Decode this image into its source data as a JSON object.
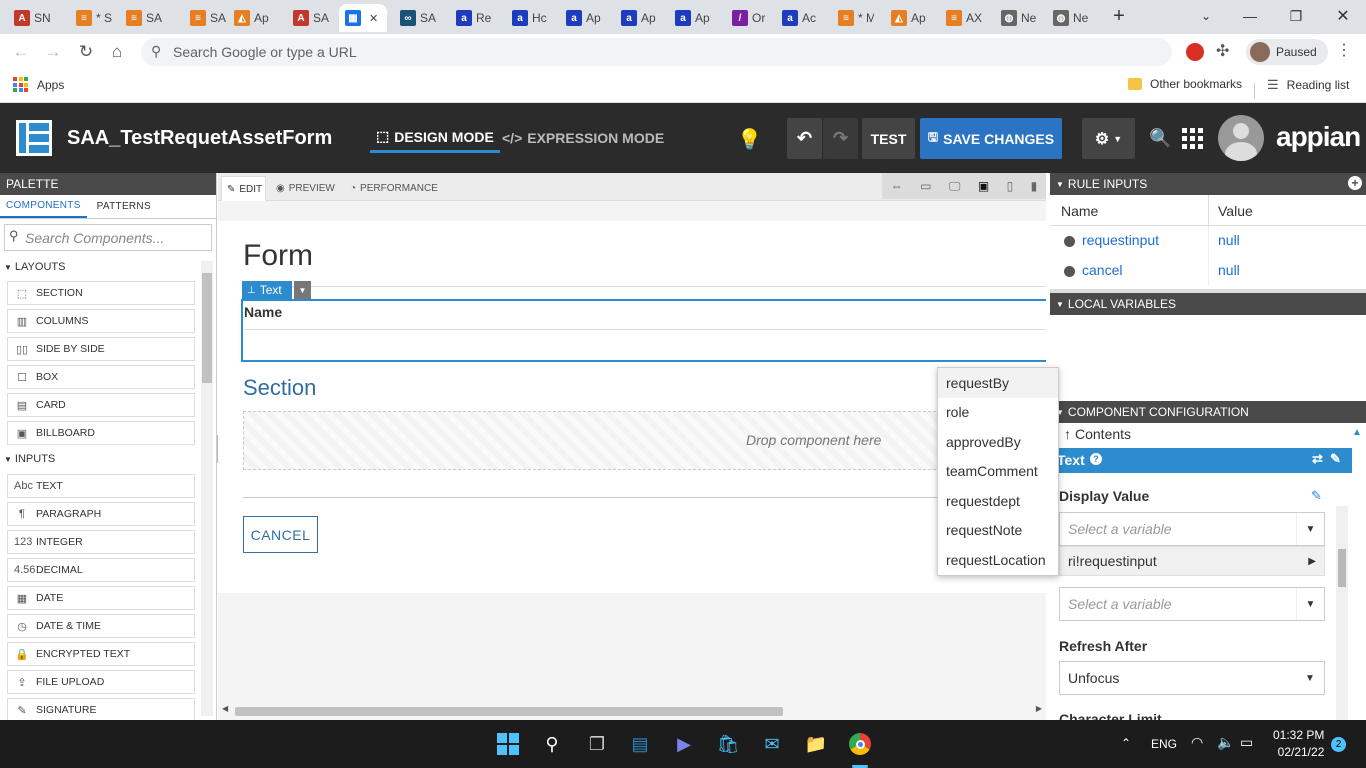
{
  "browser": {
    "tabs": [
      {
        "label": "SN",
        "color": "#c0392b",
        "glyph": "A"
      },
      {
        "label": "* S",
        "color": "#e67e22",
        "glyph": "≡"
      },
      {
        "label": "SA",
        "color": "#e67e22",
        "glyph": "≡"
      },
      {
        "label": "SA",
        "color": "#e67e22",
        "glyph": "≡"
      },
      {
        "label": "Ap",
        "color": "#e67e22",
        "glyph": "◭"
      },
      {
        "label": "SA",
        "color": "#c0392b",
        "glyph": "A"
      },
      {
        "label": "",
        "color": "#1a73e8",
        "glyph": "▦"
      },
      {
        "label": "SA",
        "color": "#1a5276",
        "glyph": "∞"
      },
      {
        "label": "Re",
        "color": "#1e3cbe",
        "glyph": "a"
      },
      {
        "label": "Hc",
        "color": "#1e3cbe",
        "glyph": "a"
      },
      {
        "label": "Ap",
        "color": "#1e3cbe",
        "glyph": "a"
      },
      {
        "label": "Ap",
        "color": "#1e3cbe",
        "glyph": "a"
      },
      {
        "label": "Ap",
        "color": "#1e3cbe",
        "glyph": "a"
      },
      {
        "label": "Or",
        "color": "#7b1fa2",
        "glyph": "/"
      },
      {
        "label": "Ac",
        "color": "#1e3cbe",
        "glyph": "a"
      },
      {
        "label": "* M",
        "color": "#e67e22",
        "glyph": "≡"
      },
      {
        "label": "Ap",
        "color": "#e67e22",
        "glyph": "◭"
      },
      {
        "label": "AX",
        "color": "#e67e22",
        "glyph": "≡"
      },
      {
        "label": "Ne",
        "color": "#666",
        "glyph": "◍"
      },
      {
        "label": "Ne",
        "color": "#666",
        "glyph": "◍"
      }
    ],
    "omnibox_placeholder": "Search Google or type a URL",
    "profile_status": "Paused",
    "apps_label": "Apps",
    "other_bookmarks": "Other bookmarks",
    "reading_list": "Reading list"
  },
  "header": {
    "app_title": "SAA_TestRequetAssetForm",
    "design_mode": "DESIGN MODE",
    "expression_mode": "EXPRESSION MODE",
    "test_label": "TEST",
    "save_label": "SAVE CHANGES",
    "logo_text": "appian"
  },
  "palette": {
    "title": "PALETTE",
    "tabs": [
      "COMPONENTS",
      "PATTERNS"
    ],
    "search_placeholder": "Search Components...",
    "layouts_label": "LAYOUTS",
    "layouts": [
      {
        "icon": "⬚",
        "label": "SECTION"
      },
      {
        "icon": "▥",
        "label": "COLUMNS"
      },
      {
        "icon": "▯▯",
        "label": "SIDE BY SIDE"
      },
      {
        "icon": "☐",
        "label": "BOX"
      },
      {
        "icon": "▤",
        "label": "CARD"
      },
      {
        "icon": "▣",
        "label": "BILLBOARD"
      }
    ],
    "inputs_label": "INPUTS",
    "inputs": [
      {
        "icon": "Abc",
        "label": "TEXT"
      },
      {
        "icon": "¶",
        "label": "PARAGRAPH"
      },
      {
        "icon": "123",
        "label": "INTEGER"
      },
      {
        "icon": "4.56",
        "label": "DECIMAL"
      },
      {
        "icon": "▦",
        "label": "DATE"
      },
      {
        "icon": "◷",
        "label": "DATE & TIME"
      },
      {
        "icon": "🔒",
        "label": "ENCRYPTED TEXT"
      },
      {
        "icon": "⇪",
        "label": "FILE UPLOAD"
      },
      {
        "icon": "✎",
        "label": "SIGNATURE"
      }
    ]
  },
  "canvas": {
    "tabs": [
      "EDIT",
      "PREVIEW",
      "PERFORMANCE"
    ],
    "form_title": "Form",
    "component_tag": "Text",
    "field_label": "Name",
    "section_title": "Section",
    "drop_hint": "Drop component here",
    "cancel_label": "CANCEL"
  },
  "rule_inputs": {
    "title": "RULE INPUTS",
    "col_name": "Name",
    "col_value": "Value",
    "rows": [
      {
        "name": "requestinput",
        "value": "null"
      },
      {
        "name": "cancel",
        "value": "null"
      }
    ]
  },
  "local_variables": {
    "title": "LOCAL VARIABLES"
  },
  "component_config": {
    "title": "COMPONENT CONFIGURATION",
    "breadcrumb": "Contents",
    "component": "Text",
    "display_value_label": "Display Value",
    "select_placeholder": "Select a variable",
    "selected_var": "ri!requestinput",
    "select_placeholder2": "Select a variable",
    "refresh_after_label": "Refresh After",
    "refresh_after_value": "Unfocus",
    "character_limit_label": "Character Limit"
  },
  "variable_dropdown": [
    "requestBy",
    "role",
    "approvedBy",
    "teamComment",
    "requestdept",
    "requestNote",
    "requestLocation"
  ],
  "taskbar": {
    "language": "ENG",
    "time": "01:32 PM",
    "date": "02/21/22",
    "notifications": "2"
  },
  "colors": {
    "accent": "#1d6fd1",
    "header_bg": "#2b2b2b",
    "link": "#1d6fd1"
  }
}
